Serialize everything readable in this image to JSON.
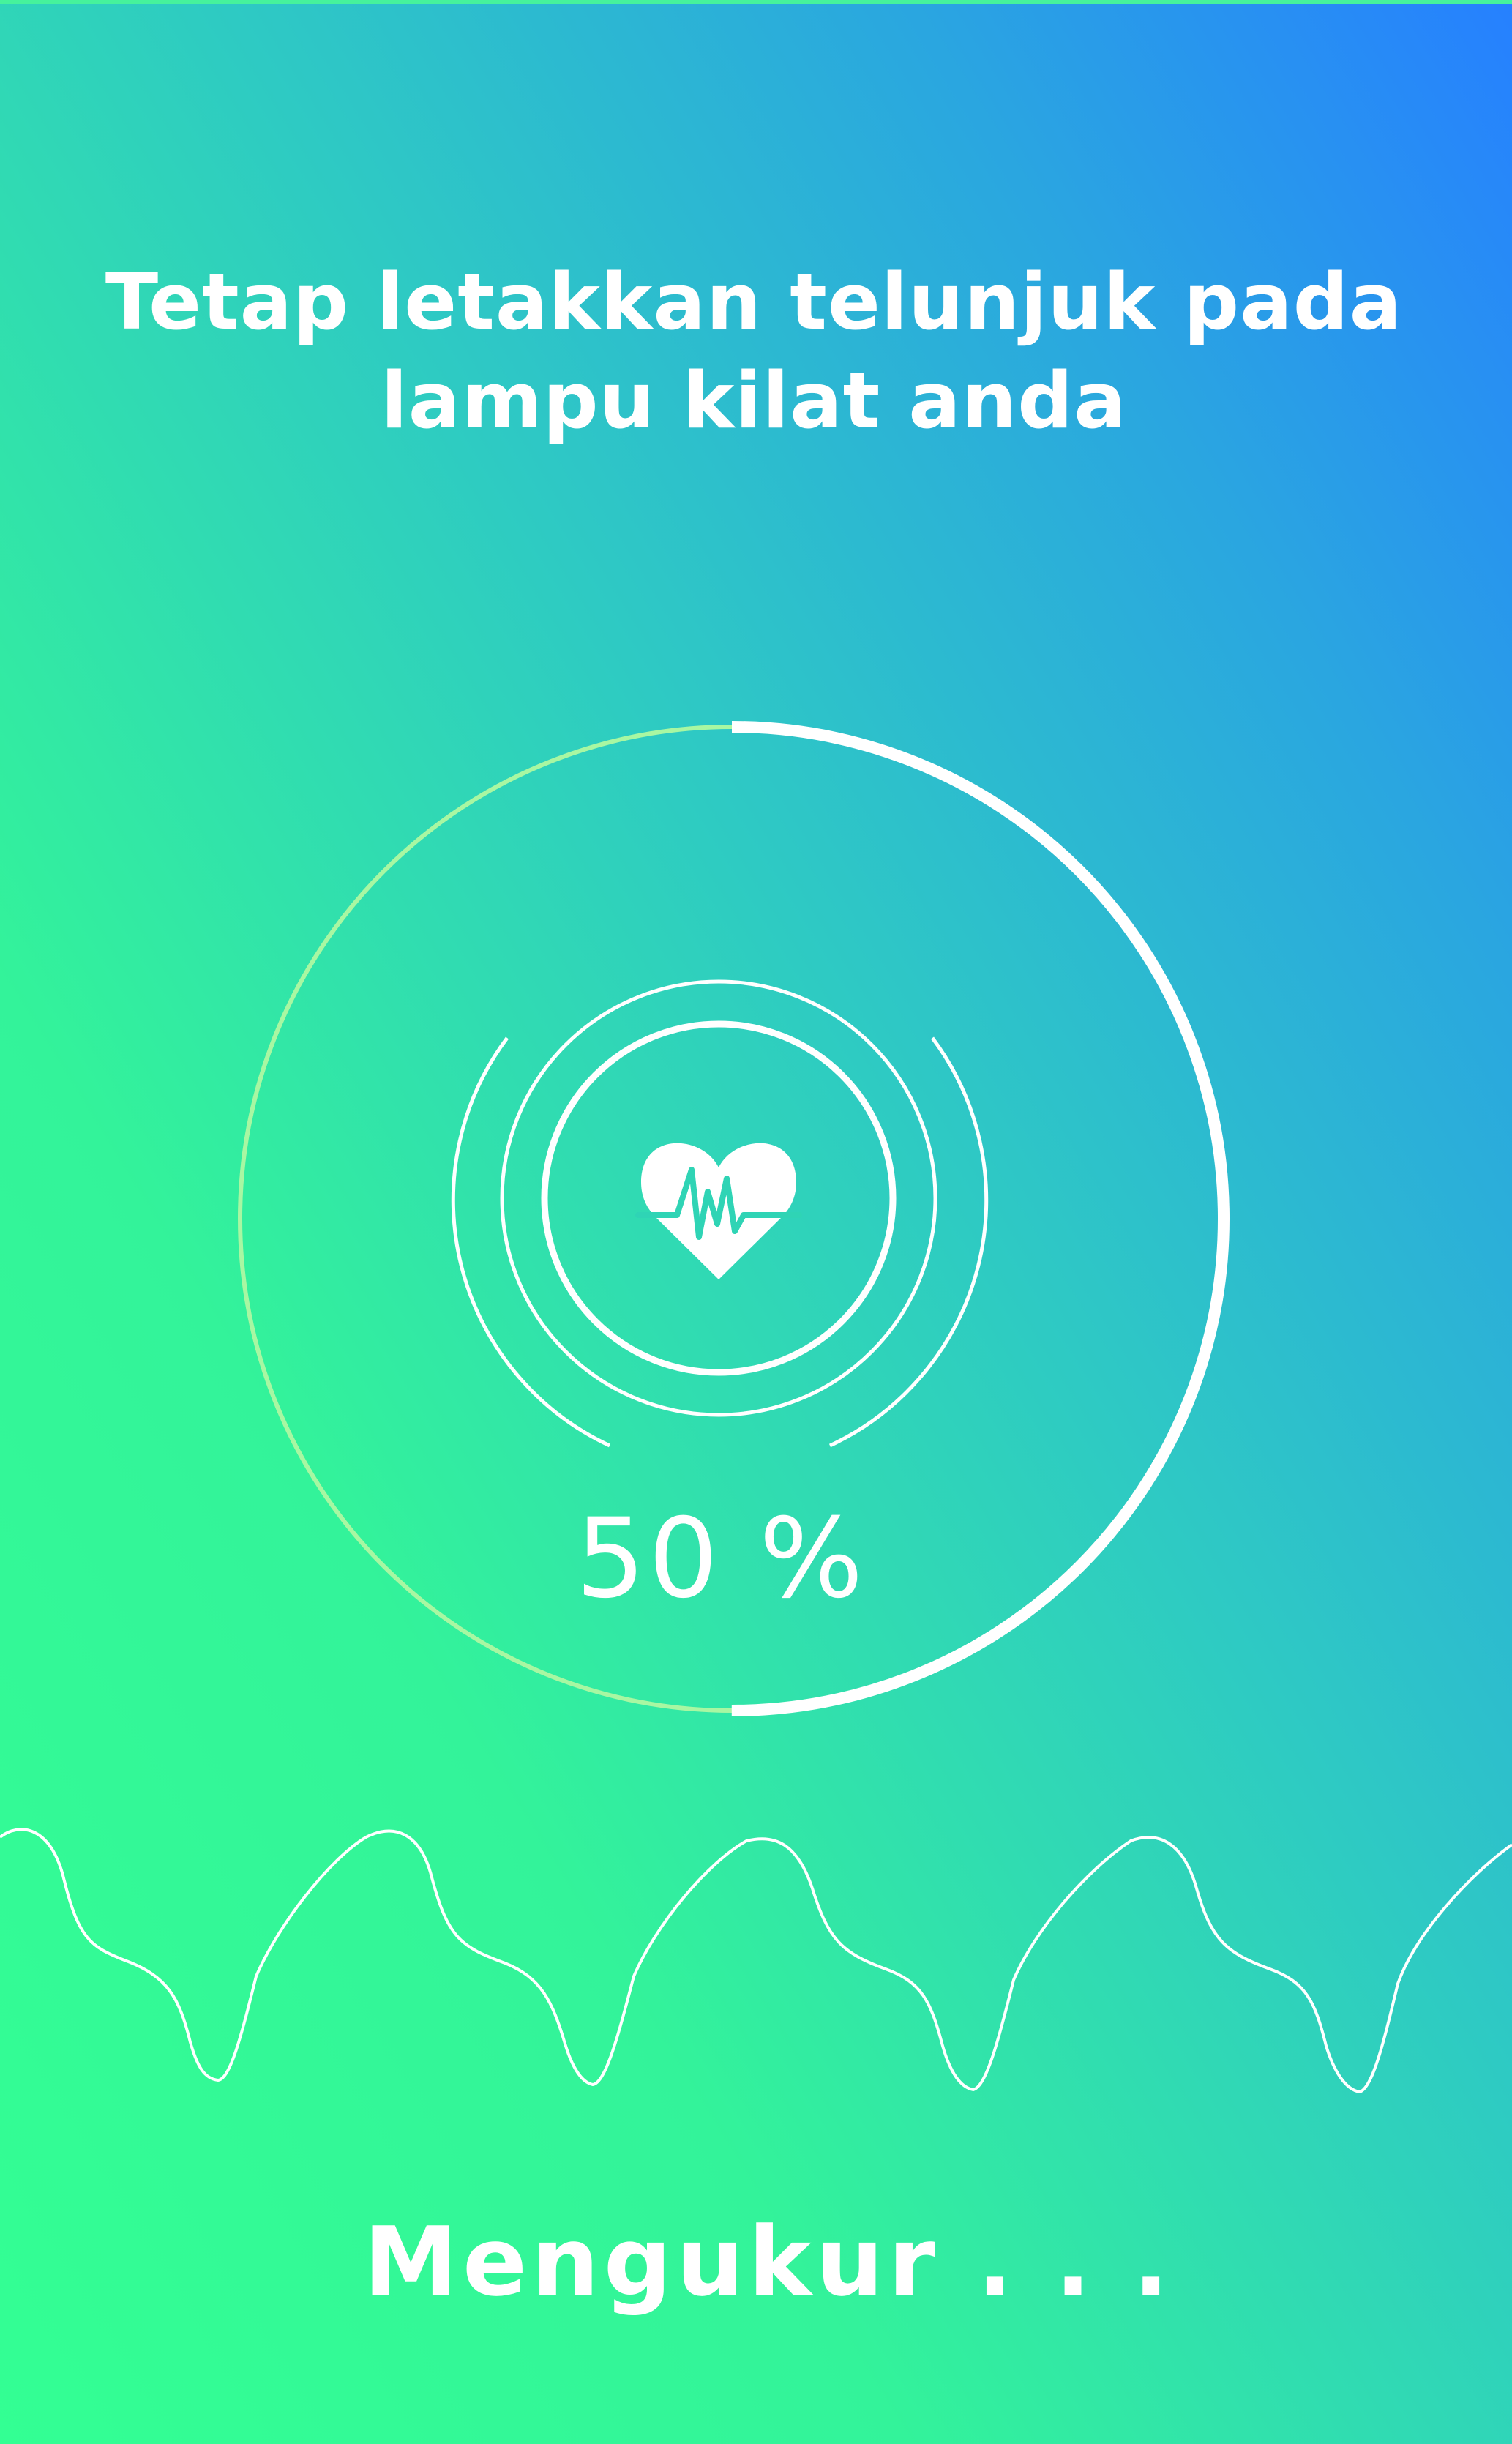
{
  "instruction": {
    "line1": "Tetap letakkan telunjuk pada",
    "line2": "lampu kilat anda"
  },
  "progress": {
    "value": 50,
    "label": "50 %"
  },
  "status": {
    "label": "Mengukur . . ."
  },
  "icons": {
    "center": "heart-pulse-icon",
    "waveform": "pulse-waveform"
  },
  "colors": {
    "gradient_start": "#33ff93",
    "gradient_end": "#2680ff",
    "progress_track": "#a8f7a2",
    "progress_fill": "#ffffff",
    "foreground": "#ffffff"
  }
}
